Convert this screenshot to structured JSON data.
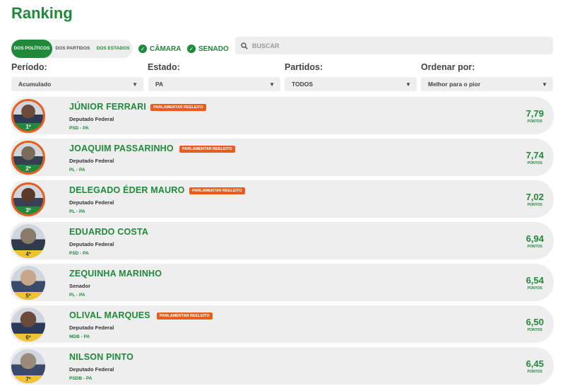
{
  "page": {
    "title": "Ranking"
  },
  "segments": [
    {
      "label": "DOS POLÍTICOS",
      "active": true
    },
    {
      "label": "DOS PARTIDOS",
      "active": false
    },
    {
      "label": "DOS ESTADOS",
      "active": false
    }
  ],
  "checks": [
    {
      "label": "CÂMARA",
      "checked": true
    },
    {
      "label": "SENADO",
      "checked": true
    }
  ],
  "search": {
    "placeholder": "BUSCAR",
    "value": ""
  },
  "filters": [
    {
      "label": "Período:",
      "value": "Acumulado"
    },
    {
      "label": "Estado:",
      "value": "PA"
    },
    {
      "label": "Partidos:",
      "value": "TODOS"
    },
    {
      "label": "Ordenar por:",
      "value": "Melhor para o pior"
    }
  ],
  "badge_text": "PARLAMENTAR REELEITO",
  "points_unit": "PONTOS",
  "colors": {
    "brand": "#1f8a3a",
    "accent": "#e85d1c",
    "gold": "#f0c330",
    "row_bg": "#eeeeee"
  },
  "politicians": [
    {
      "rank": "1º",
      "name": "JÚNIOR FERRARI",
      "role": "Deputado Federal",
      "party": "PSD - PA",
      "score": "7,79",
      "reelected": true
    },
    {
      "rank": "2º",
      "name": "JOAQUIM PASSARINHO",
      "role": "Deputado Federal",
      "party": "PL - PA",
      "score": "7,74",
      "reelected": true
    },
    {
      "rank": "3º",
      "name": "DELEGADO ÉDER MAURO",
      "role": "Deputado Federal",
      "party": "PL - PA",
      "score": "7,02",
      "reelected": true
    },
    {
      "rank": "4º",
      "name": "EDUARDO COSTA",
      "role": "Deputado Federal",
      "party": "PSD - PA",
      "score": "6,94",
      "reelected": false
    },
    {
      "rank": "5º",
      "name": "ZEQUINHA MARINHO",
      "role": "Senador",
      "party": "PL - PA",
      "score": "6,54",
      "reelected": false
    },
    {
      "rank": "6º",
      "name": "OLIVAL MARQUES",
      "role": "Deputado Federal",
      "party": "MDB - PA",
      "score": "6,50",
      "reelected": true
    },
    {
      "rank": "7º",
      "name": "NILSON PINTO",
      "role": "Deputado Federal",
      "party": "PSDB - PA",
      "score": "6,45",
      "reelected": false
    }
  ]
}
